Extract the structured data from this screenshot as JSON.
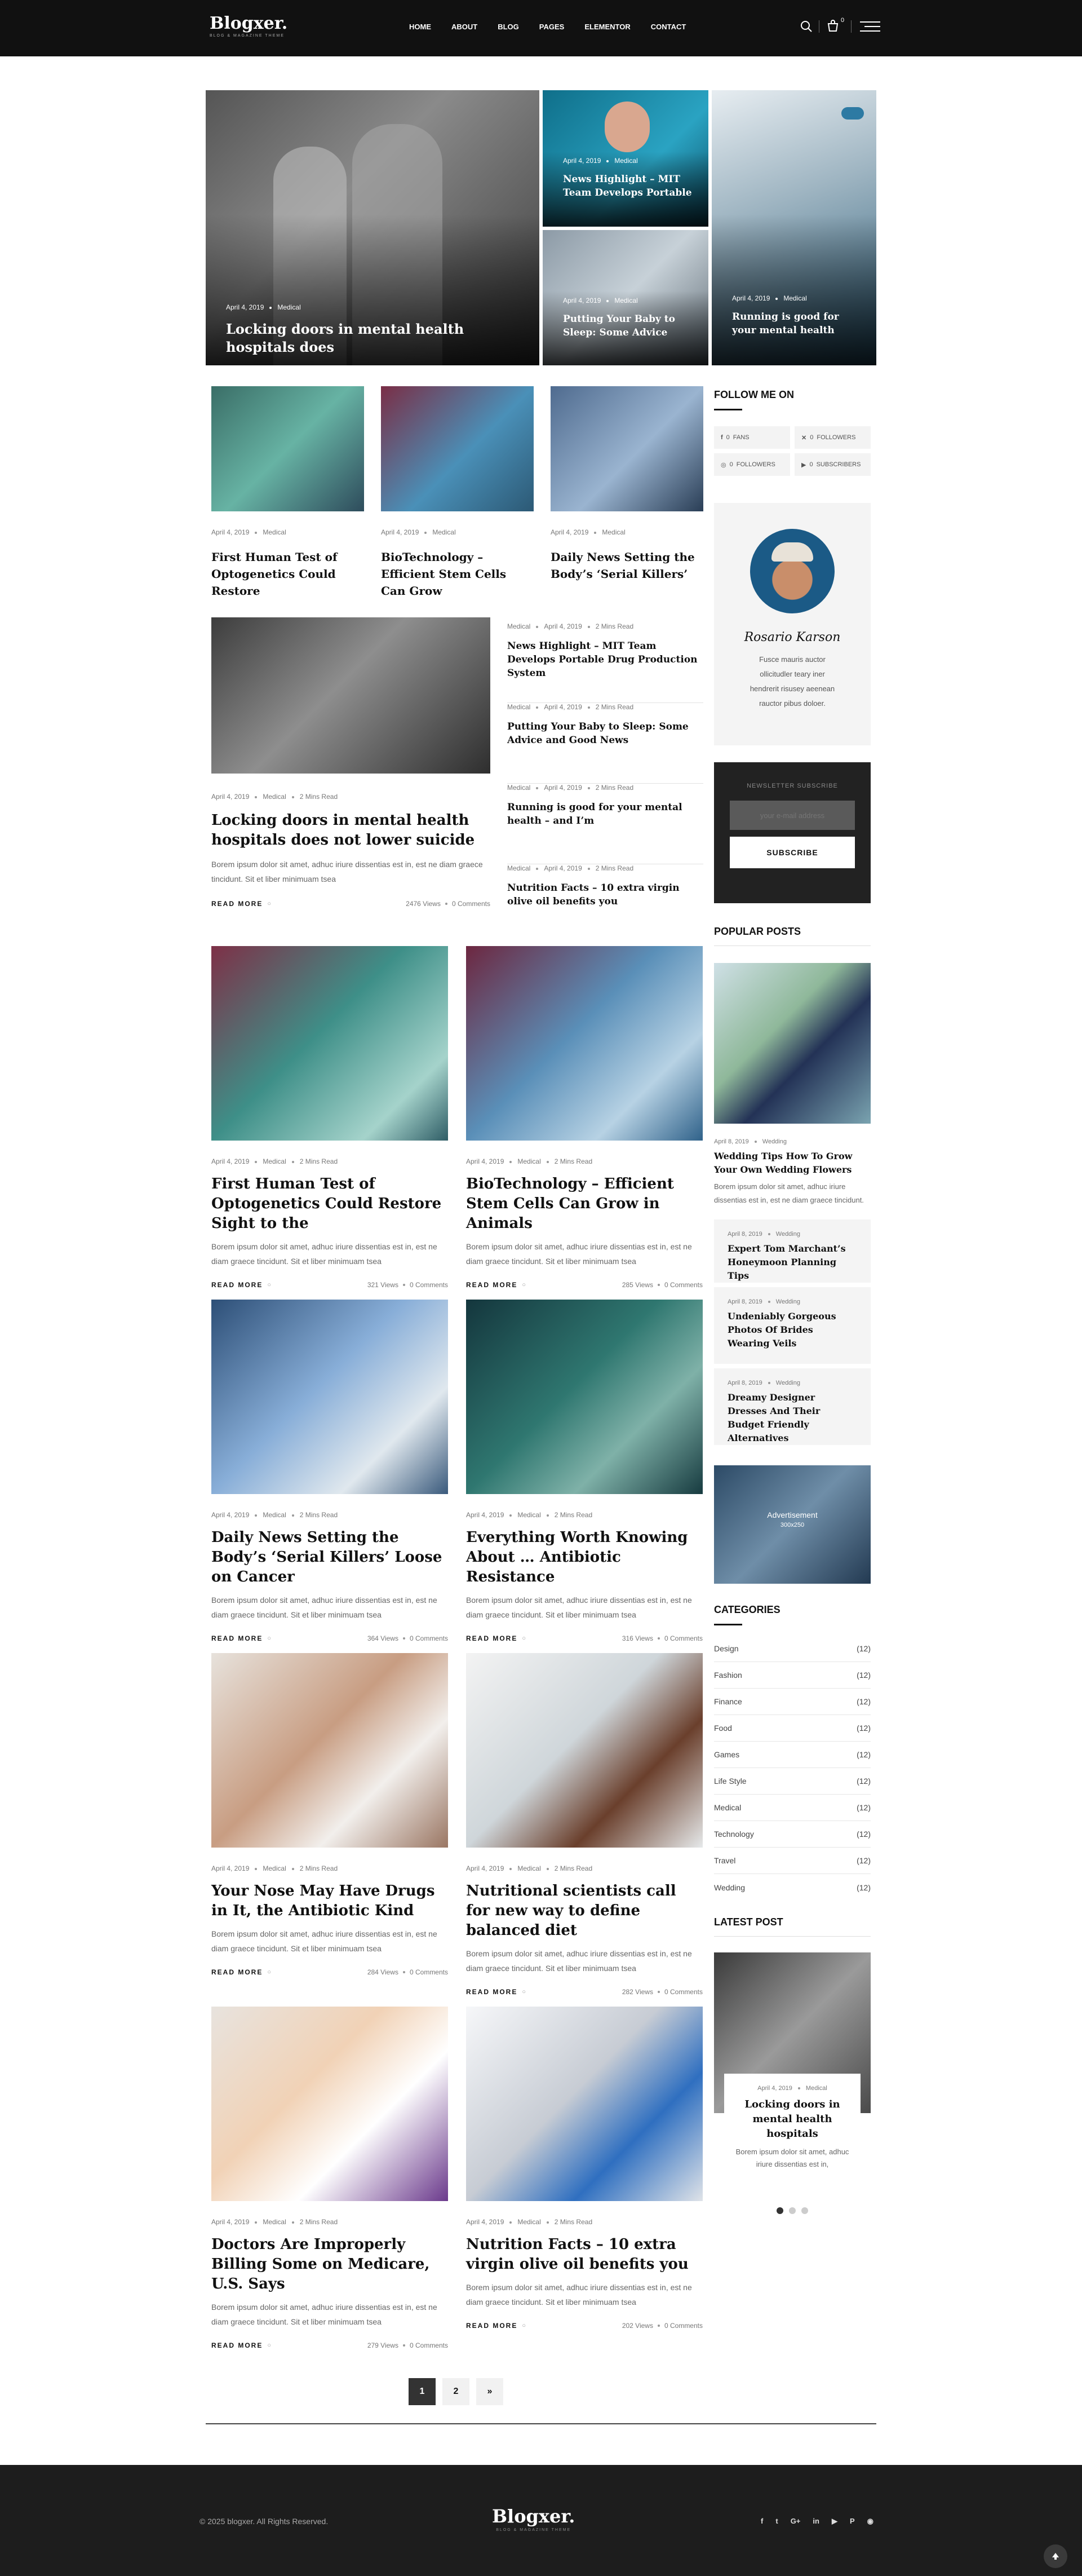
{
  "header": {
    "logo": "Blogxer.",
    "tagline": "BLOG & MAGAZINE THEME",
    "nav": [
      "HOME",
      "ABOUT",
      "BLOG",
      "PAGES",
      "ELEMENTOR",
      "CONTACT"
    ],
    "cart_count": "0"
  },
  "hero": [
    {
      "date": "April 4, 2019",
      "cat": "Medical",
      "title": "Locking doors in mental health hospitals does"
    },
    {
      "date": "April 4, 2019",
      "cat": "Medical",
      "title": "News Highlight – MIT Team Develops Portable"
    },
    {
      "date": "April 4, 2019",
      "cat": "Medical",
      "title": "Putting Your Baby to Sleep: Some Advice"
    },
    {
      "date": "April 4, 2019",
      "cat": "Medical",
      "title": "Running is good for your mental health"
    }
  ],
  "top3": [
    {
      "date": "April 4, 2019",
      "cat": "Medical",
      "title": "First Human Test of Optogenetics Could Restore"
    },
    {
      "date": "April 4, 2019",
      "cat": "Medical",
      "title": "BioTechnology – Efficient Stem Cells Can Grow"
    },
    {
      "date": "April 4, 2019",
      "cat": "Medical",
      "title": "Daily News Setting the Body’s ‘Serial Killers’"
    }
  ],
  "feature": {
    "date": "April 4, 2019",
    "cat": "Medical",
    "read": "2 Mins Read",
    "title": "Locking doors in mental health hospitals does not lower suicide",
    "excerpt": "Borem ipsum dolor sit amet, adhuc iriure dissentias est in, est ne diam graece tincidunt. Sit et liber minimuam tsea",
    "read_more": "READ MORE",
    "views": "2476 Views",
    "comments": "0 Comments"
  },
  "sidelist": [
    {
      "cat": "Medical",
      "date": "April 4, 2019",
      "read": "2 Mins Read",
      "title": "News Highlight – MIT Team Develops Portable Drug Production System"
    },
    {
      "cat": "Medical",
      "date": "April 4, 2019",
      "read": "2 Mins Read",
      "title": "Putting Your Baby to Sleep: Some Advice and Good News"
    },
    {
      "cat": "Medical",
      "date": "April 4, 2019",
      "read": "2 Mins Read",
      "title": "Running is good for your mental health – and I’m"
    },
    {
      "cat": "Medical",
      "date": "April 4, 2019",
      "read": "2 Mins Read",
      "title": "Nutrition Facts – 10 extra virgin olive oil benefits you"
    }
  ],
  "grid": [
    {
      "date": "April 4, 2019",
      "cat": "Medical",
      "read": "2 Mins Read",
      "title": "First Human Test of Optogenetics Could Restore Sight to the",
      "excerpt": "Borem ipsum dolor sit amet, adhuc iriure dissentias est in, est ne diam graece tincidunt. Sit et liber minimuam tsea",
      "read_more": "READ MORE",
      "views": "321 Views",
      "comments": "0 Comments"
    },
    {
      "date": "April 4, 2019",
      "cat": "Medical",
      "read": "2 Mins Read",
      "title": "BioTechnology – Efficient Stem Cells Can Grow in Animals",
      "excerpt": "Borem ipsum dolor sit amet, adhuc iriure dissentias est in, est ne diam graece tincidunt. Sit et liber minimuam tsea",
      "read_more": "READ MORE",
      "views": "285 Views",
      "comments": "0 Comments"
    },
    {
      "date": "April 4, 2019",
      "cat": "Medical",
      "read": "2 Mins Read",
      "title": "Daily News Setting the Body’s ‘Serial Killers’ Loose on Cancer",
      "excerpt": "Borem ipsum dolor sit amet, adhuc iriure dissentias est in, est ne diam graece tincidunt. Sit et liber minimuam tsea",
      "read_more": "READ MORE",
      "views": "364 Views",
      "comments": "0 Comments"
    },
    {
      "date": "April 4, 2019",
      "cat": "Medical",
      "read": "2 Mins Read",
      "title": "Everything Worth Knowing About … Antibiotic Resistance",
      "excerpt": "Borem ipsum dolor sit amet, adhuc iriure dissentias est in, est ne diam graece tincidunt. Sit et liber minimuam tsea",
      "read_more": "READ MORE",
      "views": "316 Views",
      "comments": "0 Comments"
    },
    {
      "date": "April 4, 2019",
      "cat": "Medical",
      "read": "2 Mins Read",
      "title": "Your Nose May Have Drugs in It, the Antibiotic Kind",
      "excerpt": "Borem ipsum dolor sit amet, adhuc iriure dissentias est in, est ne diam graece tincidunt. Sit et liber minimuam tsea",
      "read_more": "READ MORE",
      "views": "284 Views",
      "comments": "0 Comments"
    },
    {
      "date": "April 4, 2019",
      "cat": "Medical",
      "read": "2 Mins Read",
      "title": "Nutritional scientists call for new way to define balanced diet",
      "excerpt": "Borem ipsum dolor sit amet, adhuc iriure dissentias est in, est ne diam graece tincidunt. Sit et liber minimuam tsea",
      "read_more": "READ MORE",
      "views": "282 Views",
      "comments": "0 Comments"
    },
    {
      "date": "April 4, 2019",
      "cat": "Medical",
      "read": "2 Mins Read",
      "title": "Doctors Are Improperly Billing Some on Medicare, U.S. Says",
      "excerpt": "Borem ipsum dolor sit amet, adhuc iriure dissentias est in, est ne diam graece tincidunt. Sit et liber minimuam tsea",
      "read_more": "READ MORE",
      "views": "279 Views",
      "comments": "0 Comments"
    },
    {
      "date": "April 4, 2019",
      "cat": "Medical",
      "read": "2 Mins Read",
      "title": "Nutrition Facts – 10 extra virgin olive oil benefits you",
      "excerpt": "Borem ipsum dolor sit amet, adhuc iriure dissentias est in, est ne diam graece tincidunt. Sit et liber minimuam tsea",
      "read_more": "READ MORE",
      "views": "202 Views",
      "comments": "0 Comments"
    }
  ],
  "pagination": {
    "current": "1",
    "next": "2",
    "arrow": "»"
  },
  "sidebar": {
    "follow_title": "FOLLOW ME ON",
    "follow": [
      {
        "count": "0",
        "label": "FANS"
      },
      {
        "count": "0",
        "label": "FOLLOWERS"
      },
      {
        "count": "0",
        "label": "FOLLOWERS"
      },
      {
        "count": "0",
        "label": "SUBSCRIBERS"
      }
    ],
    "author": {
      "signature": "Rosario Karson",
      "bio": "Fusce mauris auctor ollicitudler teary iner hendrerit risusey aeenean rauctor pibus doloer."
    },
    "newsletter": {
      "title": "NEWSLETTER SUBSCRIBE",
      "placeholder": "your e-mail address",
      "button": "SUBSCRIBE"
    },
    "popular_title": "POPULAR POSTS",
    "popular_main": {
      "date": "April 8, 2019",
      "cat": "Wedding",
      "title": "Wedding Tips How To Grow Your Own Wedding Flowers",
      "excerpt": "Borem ipsum dolor sit amet, adhuc iriure dissentias est in, est ne diam graece tincidunt."
    },
    "popular": [
      {
        "date": "April 8, 2019",
        "cat": "Wedding",
        "title": "Expert Tom Marchant’s Honeymoon Planning Tips"
      },
      {
        "date": "April 8, 2019",
        "cat": "Wedding",
        "title": "Undeniably Gorgeous Photos Of Brides Wearing Veils"
      },
      {
        "date": "April 8, 2019",
        "cat": "Wedding",
        "title": "Dreamy Designer Dresses And Their Budget Friendly Alternatives"
      }
    ],
    "ad": {
      "line1": "Advertisement",
      "line2": "300x250"
    },
    "categories_title": "CATEGORIES",
    "categories": [
      {
        "name": "Design",
        "count": "(12)"
      },
      {
        "name": "Fashion",
        "count": "(12)"
      },
      {
        "name": "Finance",
        "count": "(12)"
      },
      {
        "name": "Food",
        "count": "(12)"
      },
      {
        "name": "Games",
        "count": "(12)"
      },
      {
        "name": "Life Style",
        "count": "(12)"
      },
      {
        "name": "Medical",
        "count": "(12)"
      },
      {
        "name": "Technology",
        "count": "(12)"
      },
      {
        "name": "Travel",
        "count": "(12)"
      },
      {
        "name": "Wedding",
        "count": "(12)"
      }
    ],
    "latest_title": "LATEST POST",
    "latest": {
      "date": "April 4, 2019",
      "cat": "Medical",
      "title": "Locking doors in mental health hospitals",
      "excerpt": "Borem ipsum dolor sit amet, adhuc iriure dissentias est in,"
    }
  },
  "footer": {
    "copyright": "© 2025 blogxer. All Rights Reserved.",
    "logo": "Blogxer.",
    "tagline": "BLOG & MAGAZINE THEME"
  },
  "colors": {
    "dark": "#111111",
    "footer": "#1d1d1d",
    "light_bg": "#f4f4f4"
  }
}
